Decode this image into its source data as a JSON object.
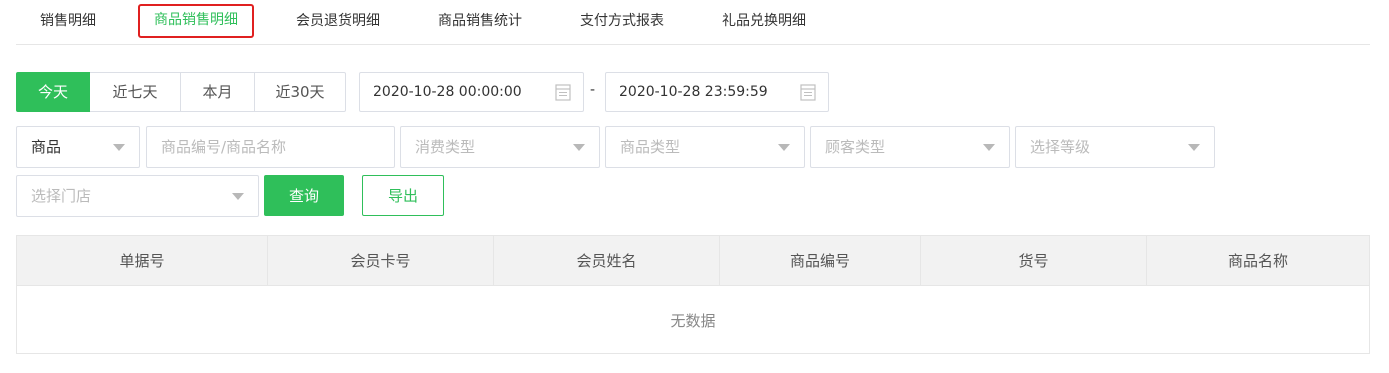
{
  "tabs": [
    {
      "label": "销售明细"
    },
    {
      "label": "商品销售明细"
    },
    {
      "label": "会员退货明细"
    },
    {
      "label": "商品销售统计"
    },
    {
      "label": "支付方式报表"
    },
    {
      "label": "礼品兑换明细"
    }
  ],
  "active_tab": "商品销售明细",
  "quick_dates": [
    {
      "label": "今天"
    },
    {
      "label": "近七天"
    },
    {
      "label": "本月"
    },
    {
      "label": "近30天"
    }
  ],
  "date_range": {
    "start": "2020-10-28 00:00:00",
    "separator": "-",
    "end": "2020-10-28 23:59:59"
  },
  "filters": {
    "search_type": "商品",
    "search_placeholder": "商品编号/商品名称",
    "consume_type": "消费类型",
    "product_type": "商品类型",
    "customer_type": "顾客类型",
    "level": "选择等级",
    "store": "选择门店"
  },
  "actions": {
    "query": "查询",
    "export": "导出"
  },
  "table": {
    "columns": [
      "单据号",
      "会员卡号",
      "会员姓名",
      "商品编号",
      "货号",
      "商品名称"
    ],
    "empty_text": "无数据"
  },
  "colors": {
    "accent": "#2fbf5a",
    "highlight_border": "#e02020",
    "border": "#dcdfe6",
    "header_bg": "#f2f2f2"
  },
  "icons": {
    "date_icon": "calendar-icon",
    "select_icon": "caret-down-icon"
  }
}
